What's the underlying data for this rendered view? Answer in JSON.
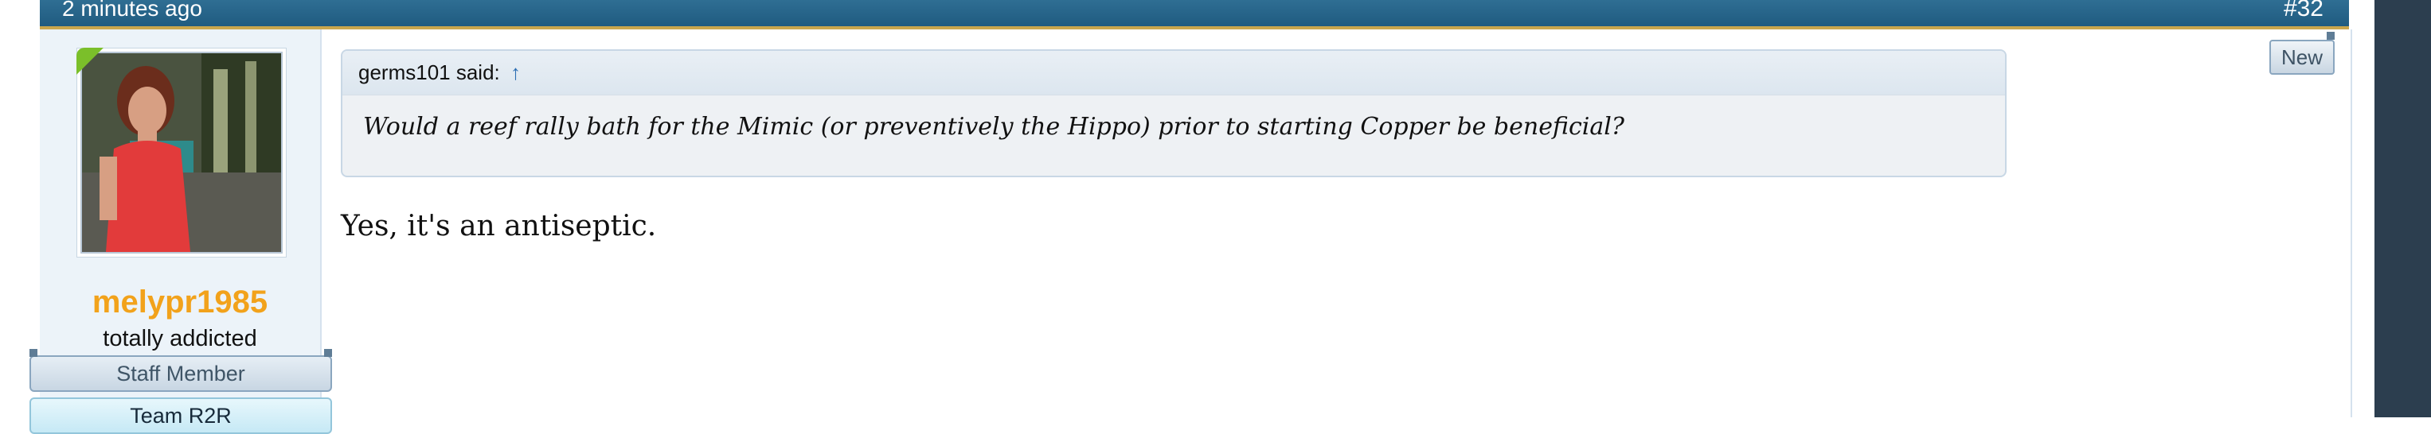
{
  "post": {
    "time": "2 minutes ago",
    "number": "#32",
    "new_label": "New"
  },
  "user": {
    "username": "melypr1985",
    "title": "totally addicted",
    "banners": [
      "Staff Member",
      "Team R2R"
    ]
  },
  "quote": {
    "author_label": "germs101 said:",
    "jump_icon": "↑",
    "text": "Would a reef rally bath for the Mimic (or preventively the Hippo) prior to starting Copper be beneficial?"
  },
  "message": {
    "text": "Yes, it's an antiseptic."
  },
  "colors": {
    "topbar": "#2a6a8e",
    "username": "#f2a21b",
    "online_indicator": "#7bbf2a",
    "page_edge": "#2c3e4f"
  }
}
